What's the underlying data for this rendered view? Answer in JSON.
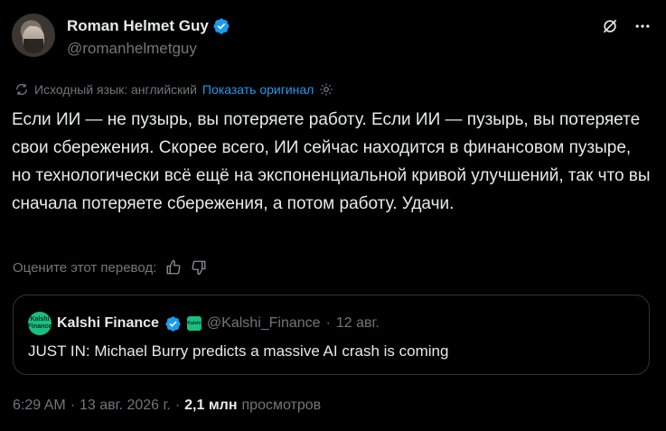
{
  "author": {
    "display_name": "Roman Helmet Guy",
    "handle": "@romanhelmetguy"
  },
  "icons": {
    "verified": "verified-badge-icon",
    "grok": "grok-icon",
    "more": "more-options-icon",
    "translate": "translate-icon",
    "settings": "gear-icon"
  },
  "translation": {
    "source_label": "Исходный язык: английский",
    "show_original": "Показать оригинал",
    "rate_label": "Оцените этот перевод:"
  },
  "tweet": {
    "text": "Если ИИ — не пузырь, вы потеряете работу. Если ИИ — пузырь, вы потеряете свои сбережения. Скорее всего, ИИ сейчас находится в финансовом пузыре, но технологически всё ещё на экспоненциальной кривой улучшений, так что вы сначала потеряете сбережения, а потом работу. Удачи."
  },
  "quote": {
    "avatar_text_1": "Kalshi",
    "avatar_text_2": "Finance",
    "square_text": "Kalshi",
    "display_name": "Kalshi Finance",
    "handle": "@Kalshi_Finance",
    "separator": "·",
    "date": "12 авг.",
    "text": "JUST IN: Michael Burry predicts a massive AI crash is coming"
  },
  "footer": {
    "time": "6:29 AM",
    "sep1": "·",
    "date": "13 авг. 2026 г.",
    "sep2": "·",
    "views_count": "2,1 млн",
    "views_label": "просмотров"
  },
  "colors": {
    "background": "#000000",
    "text": "#e7e9ea",
    "muted": "#71767b",
    "link": "#1d9bf0",
    "verified": "#1d9bf0",
    "kalshi_green": "#17c07f",
    "border": "#2f3336"
  }
}
